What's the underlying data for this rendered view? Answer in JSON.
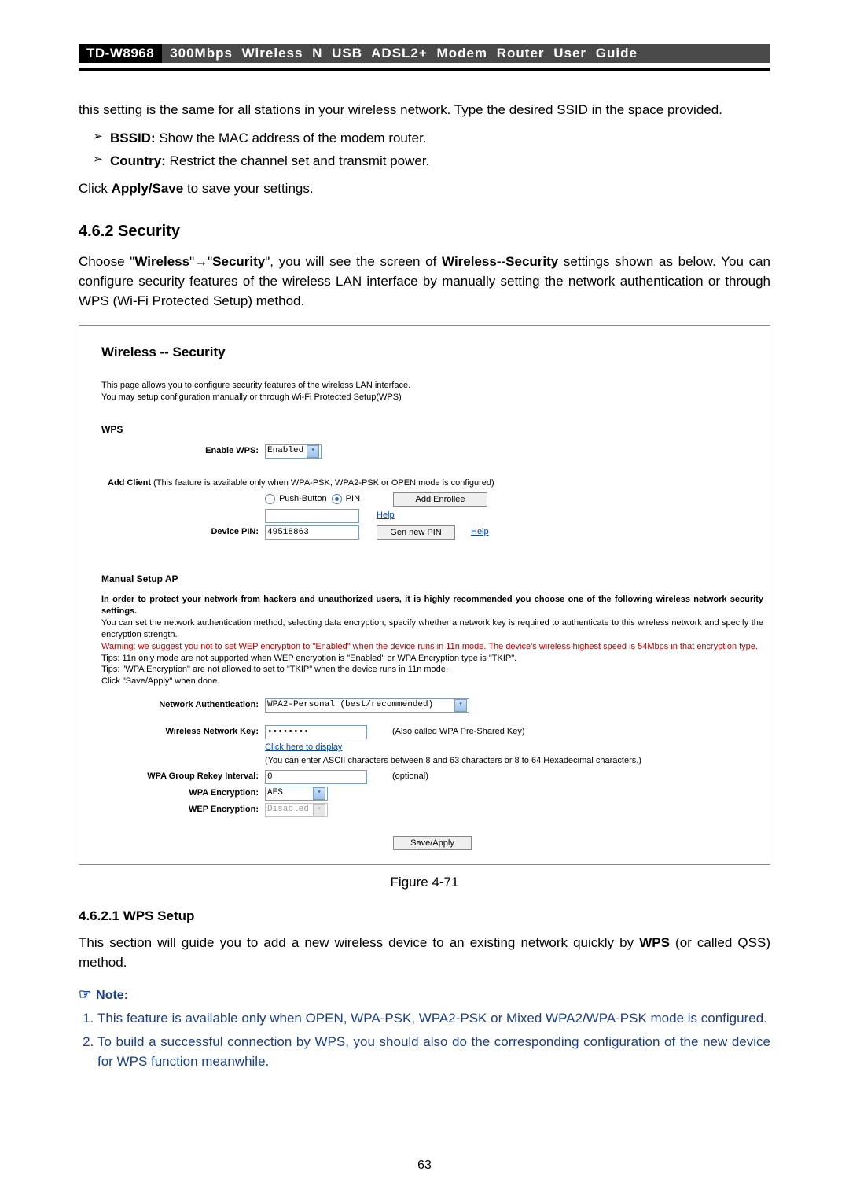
{
  "header": {
    "model": "TD-W8968",
    "title": "300Mbps Wireless N USB ADSL2+ Modem Router User Guide"
  },
  "intro": "this setting is the same for all stations in your wireless network. Type the desired SSID in the space provided.",
  "bullets": [
    {
      "term": "BSSID:",
      "desc": " Show the MAC address of the modem router."
    },
    {
      "term": "Country:",
      "desc": " Restrict the channel set and transmit power."
    }
  ],
  "apply_line_pre": "Click ",
  "apply_line_bold": "Apply/Save",
  "apply_line_post": " to save your settings.",
  "section_462": "4.6.2  Security",
  "section_462_body": {
    "pre1": "Choose \"",
    "b1": "Wireless",
    "arrow": "\"→\"",
    "b2": "Security",
    "mid": "\", you will see the screen of ",
    "b3": "Wireless--Security",
    "post": " settings shown as below. You can configure security features of the wireless LAN interface by manually setting the network authentication or through WPS (Wi-Fi Protected Setup) method."
  },
  "figure": {
    "title": "Wireless -- Security",
    "desc1": "This page allows you to configure security features of the wireless LAN interface.",
    "desc2": "You may setup configuration manually or through Wi-Fi Protected Setup(WPS)",
    "wps_heading": "WPS",
    "enable_wps_label": "Enable WPS:",
    "enable_wps_value": "Enabled",
    "add_client_label_bold": "Add Client",
    "add_client_label_rest": " (This feature is available only when WPA-PSK, WPA2-PSK or OPEN mode is configured)",
    "radio_pushbutton": "Push-Button",
    "radio_pin": "PIN",
    "add_enrollee_btn": "Add Enrollee",
    "help_link": "Help",
    "device_pin_label": "Device PIN:",
    "device_pin_value": "49518863",
    "gen_new_pin_btn": "Gen new PIN",
    "manual_heading": "Manual Setup AP",
    "manual_p1": "In order to protect your network from hackers and unauthorized users, it is highly recommended you choose one of the following wireless network security settings.",
    "manual_p2": "You can set the network authentication method, selecting data encryption, specify whether a network key is required to authenticate to this wireless network and specify the encryption strength.",
    "manual_warn": "Warning: we suggest you not to set WEP encryption to \"Enabled\" when the device runs in 11n mode. The device's wireless highest speed is 54Mbps in that encryption type.",
    "manual_tip1": "Tips: 11n only mode are not supported when WEP encryption is \"Enabled\" or WPA Encryption type is \"TKIP\".",
    "manual_tip2": "Tips: \"WPA Encryption\" are not allowed to set to \"TKIP\" when the device runs in 11n mode.",
    "manual_tip3": "Click \"Save/Apply\" when done.",
    "net_auth_label": "Network Authentication:",
    "net_auth_value": "WPA2-Personal (best/recommended)",
    "net_key_label": "Wireless Network Key:",
    "net_key_value": "••••••••",
    "net_key_note": "(Also called WPA Pre-Shared Key)",
    "click_display": "Click here to display",
    "key_hint": "(You can enter ASCII characters between 8 and 63 characters or 8 to 64 Hexadecimal characters.)",
    "rekey_label": "WPA Group Rekey Interval:",
    "rekey_value": "0",
    "rekey_note": "(optional)",
    "wpa_enc_label": "WPA Encryption:",
    "wpa_enc_value": "AES",
    "wep_enc_label": "WEP Encryption:",
    "wep_enc_value": "Disabled",
    "save_btn": "Save/Apply"
  },
  "figure_caption": "Figure 4-71",
  "section_4621": "4.6.2.1  WPS Setup",
  "wps_body_pre": "This section will guide you to add a new wireless device to an existing network quickly by ",
  "wps_body_bold": "WPS",
  "wps_body_post": " (or called QSS) method.",
  "note_label": "Note:",
  "notes": [
    "This feature is available only when OPEN, WPA-PSK, WPA2-PSK or Mixed WPA2/WPA-PSK mode is configured.",
    "To build a successful connection by WPS, you should also do the corresponding configuration of the new device for WPS function meanwhile."
  ],
  "page_number": "63"
}
